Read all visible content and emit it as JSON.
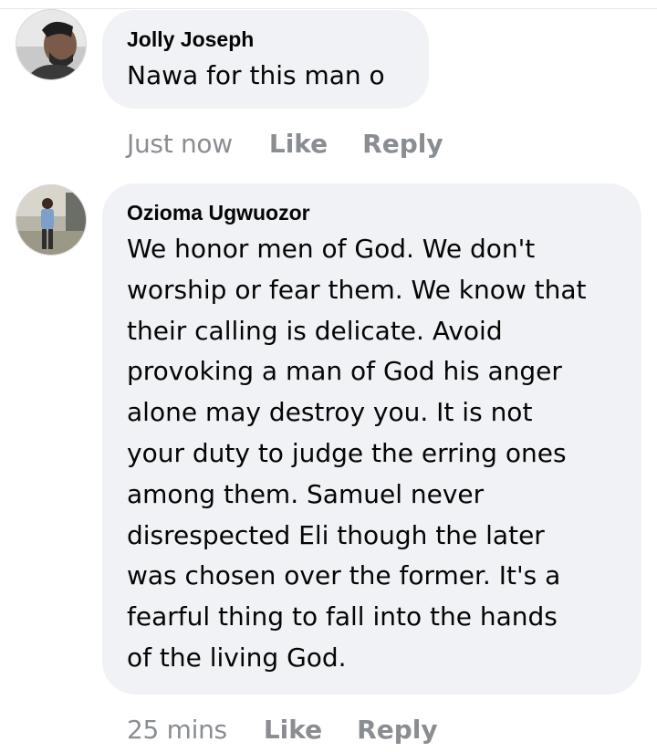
{
  "comments": [
    {
      "author": "Jolly Joseph",
      "text": "Nawa for this man o",
      "time": "Just now",
      "like_label": "Like",
      "reply_label": "Reply"
    },
    {
      "author": "Ozioma Ugwuozor",
      "text": "We honor men of God. We don't\nworship or fear them. We know that\ntheir calling is delicate. Avoid\nprovoking a man of God his anger\nalone may destroy you. It is not\nyour duty to judge the erring ones\namong them. Samuel never\ndisrespected Eli though the later\nwas chosen over the former. It's a\nfearful thing to fall into the hands\nof the living God.",
      "time": "25 mins",
      "like_label": "Like",
      "reply_label": "Reply"
    }
  ],
  "colors": {
    "bubble": "#f0f2f5",
    "text": "#050505",
    "meta": "#8a8d91"
  }
}
